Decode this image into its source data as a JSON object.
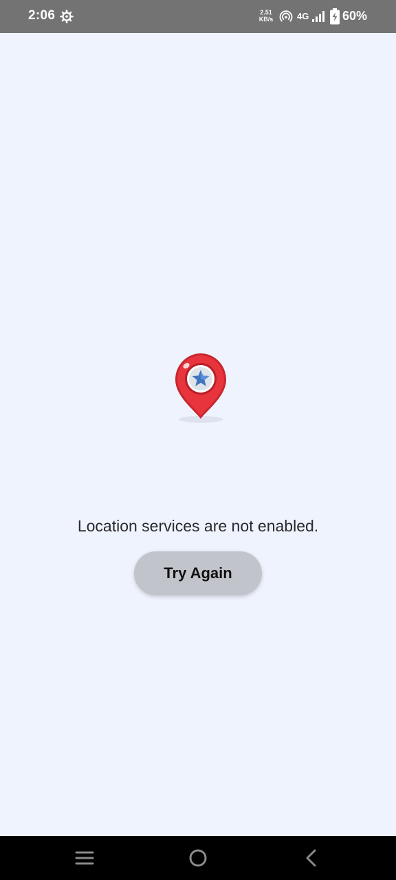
{
  "status_bar": {
    "time": "2:06",
    "speed_value": "2.51",
    "speed_unit": "KB/s",
    "network_type": "4G",
    "battery_percent": "60%",
    "icons": [
      "gear-icon",
      "hotspot-icon",
      "signal-icon",
      "battery-charging-icon"
    ]
  },
  "content": {
    "illustration": "location-pin-star-icon",
    "message": "Location services are not enabled.",
    "retry_label": "Try Again"
  },
  "nav_bar": {
    "icons": [
      "menu-icon",
      "home-icon",
      "back-icon"
    ]
  },
  "colors": {
    "background": "#eff3fd",
    "status_bar": "#737373",
    "button": "#c2c4cb",
    "pin_red": "#e8343c",
    "star_blue": "#3f74bf"
  }
}
